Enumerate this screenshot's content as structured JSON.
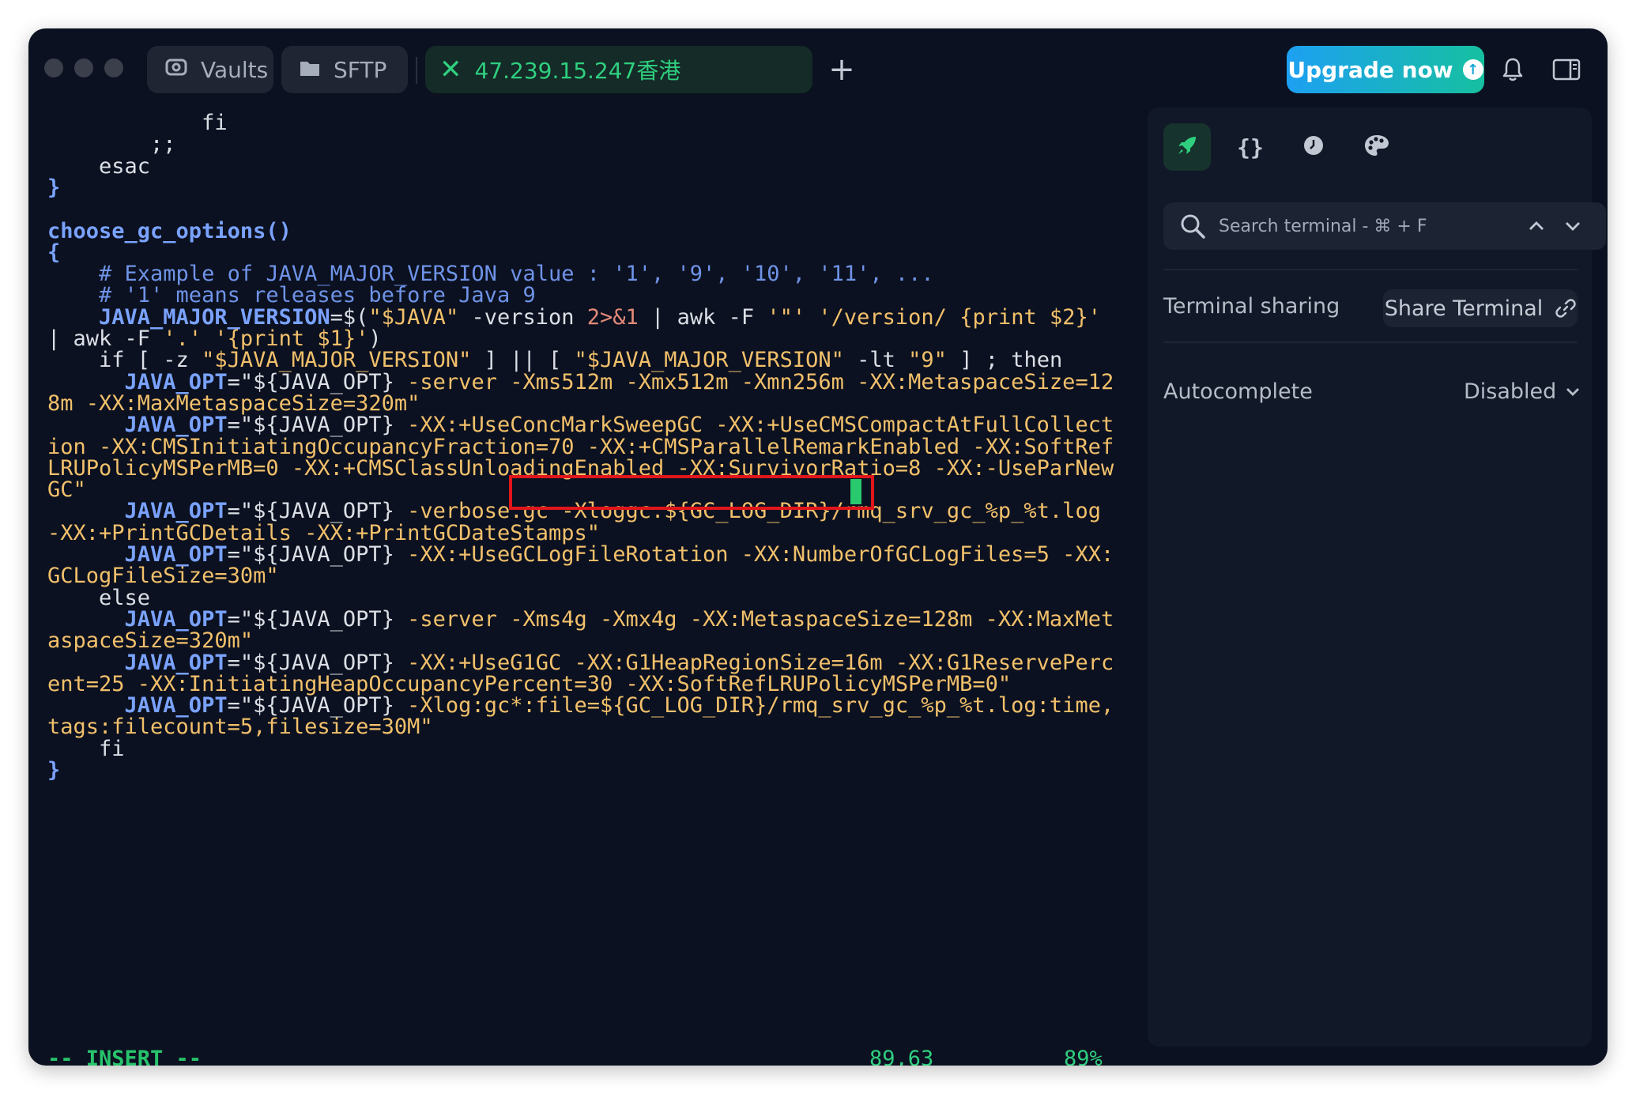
{
  "titlebar": {
    "tabs": [
      {
        "label": "Vaults"
      },
      {
        "label": "SFTP"
      },
      {
        "label": "47.239.15.247香港"
      }
    ],
    "new_tab": "+",
    "upgrade_label": "Upgrade now",
    "upgrade_arrow": "↑"
  },
  "terminal": {
    "lines": [
      [
        [
          "pl",
          "            fi"
        ]
      ],
      [
        [
          "pl",
          "        ;;"
        ]
      ],
      [
        [
          "pl",
          "    esac"
        ]
      ],
      [
        [
          "kw",
          "}"
        ]
      ],
      [
        [
          "pl",
          ""
        ]
      ],
      [
        [
          "fn",
          "choose_gc_options()"
        ]
      ],
      [
        [
          "kw",
          "{"
        ]
      ],
      [
        [
          "cm",
          "    # Example of JAVA_MAJOR_VERSION value : '1', '9', '10', '11', ..."
        ]
      ],
      [
        [
          "cm",
          "    # '1' means releases before Java 9"
        ]
      ],
      [
        [
          "kw",
          "    JAVA_MAJOR_VERSION"
        ],
        [
          "pl",
          "=$("
        ],
        [
          "str",
          "\"$JAVA\""
        ],
        [
          "pl",
          " -version "
        ],
        [
          "op",
          "2>&1"
        ],
        [
          "pl",
          " | awk -F "
        ],
        [
          "str",
          "'\"' '/version/ {print $2}'"
        ]
      ],
      [
        [
          "pl",
          "| awk -F "
        ],
        [
          "str",
          "'.' '{print $1}'"
        ],
        [
          "pl",
          ")"
        ]
      ],
      [
        [
          "pl",
          "    if [ -z "
        ],
        [
          "str",
          "\"$JAVA_MAJOR_VERSION\""
        ],
        [
          "pl",
          " ] || [ "
        ],
        [
          "str",
          "\"$JAVA_MAJOR_VERSION\""
        ],
        [
          "pl",
          " -lt "
        ],
        [
          "str",
          "\"9\""
        ],
        [
          "pl",
          " ] ; then"
        ]
      ],
      [
        [
          "kw",
          "      JAVA_OPT"
        ],
        [
          "pl",
          "=\"${JAVA_OPT}"
        ],
        [
          "str",
          " -server -Xms512m -Xmx512m -Xmn256m -XX:MetaspaceSize=12"
        ]
      ],
      [
        [
          "str",
          "8m -XX:MaxMetaspaceSize=320m\""
        ]
      ],
      [
        [
          "kw",
          "      JAVA_OPT"
        ],
        [
          "pl",
          "=\"${JAVA_OPT}"
        ],
        [
          "str",
          " -XX:+UseConcMarkSweepGC -XX:+UseCMSCompactAtFullCollect"
        ]
      ],
      [
        [
          "str",
          "ion -XX:CMSInitiatingOccupancyFraction=70 -XX:+CMSParallelRemarkEnabled -XX:SoftRef"
        ]
      ],
      [
        [
          "str",
          "LRUPolicyMSPerMB=0 -XX:+CMSClassUnloadingEnabled -XX:SurvivorRatio=8 -XX:-UseParNew"
        ]
      ],
      [
        [
          "str",
          "GC\""
        ]
      ],
      [
        [
          "kw",
          "      JAVA_OPT"
        ],
        [
          "pl",
          "=\"${JAVA_OPT}"
        ],
        [
          "str",
          " -verbose:gc -Xloggc:${GC_LOG_DIR}/rmq_srv_gc_%p_%t.log"
        ]
      ],
      [
        [
          "str",
          "-XX:+PrintGCDetails -XX:+PrintGCDateStamps\""
        ]
      ],
      [
        [
          "kw",
          "      JAVA_OPT"
        ],
        [
          "pl",
          "=\"${JAVA_OPT}"
        ],
        [
          "str",
          " -XX:+UseGCLogFileRotation -XX:NumberOfGCLogFiles=5 -XX:"
        ]
      ],
      [
        [
          "str",
          "GCLogFileSize=30m\""
        ]
      ],
      [
        [
          "pl",
          "    else"
        ]
      ],
      [
        [
          "kw",
          "      JAVA_OPT"
        ],
        [
          "pl",
          "=\"${JAVA_OPT}"
        ],
        [
          "str",
          " -server -Xms4g -Xmx4g -XX:MetaspaceSize=128m -XX:MaxMet"
        ]
      ],
      [
        [
          "str",
          "aspaceSize=320m\""
        ]
      ],
      [
        [
          "kw",
          "      JAVA_OPT"
        ],
        [
          "pl",
          "=\"${JAVA_OPT}"
        ],
        [
          "str",
          " -XX:+UseG1GC -XX:G1HeapRegionSize=16m -XX:G1ReservePerc"
        ]
      ],
      [
        [
          "str",
          "ent=25 -XX:InitiatingHeapOccupancyPercent=30 -XX:SoftRefLRUPolicyMSPerMB=0\""
        ]
      ],
      [
        [
          "kw",
          "      JAVA_OPT"
        ],
        [
          "pl",
          "=\"${JAVA_OPT}"
        ],
        [
          "str",
          " -Xlog:gc*:file=${GC_LOG_DIR}/rmq_srv_gc_%p_%t.log:time,"
        ]
      ],
      [
        [
          "str",
          "tags:filecount=5,filesize=30M\""
        ]
      ],
      [
        [
          "pl",
          "    fi"
        ]
      ],
      [
        [
          "kw",
          "}"
        ]
      ]
    ],
    "status_mode": "-- INSERT --",
    "status_position": "89,63",
    "status_percent": "89%"
  },
  "panel": {
    "search_placeholder": "Search terminal - ⌘ + F",
    "sharing_label": "Terminal sharing",
    "share_button": "Share Terminal",
    "autocomplete_label": "Autocomplete",
    "autocomplete_value": "Disabled"
  },
  "colors": {
    "background": "#0b1120",
    "accent_green": "#2fcf7f",
    "highlight_red": "#e0161b",
    "upgrade_start": "#1da0f2",
    "upgrade_end": "#16c0a0"
  }
}
